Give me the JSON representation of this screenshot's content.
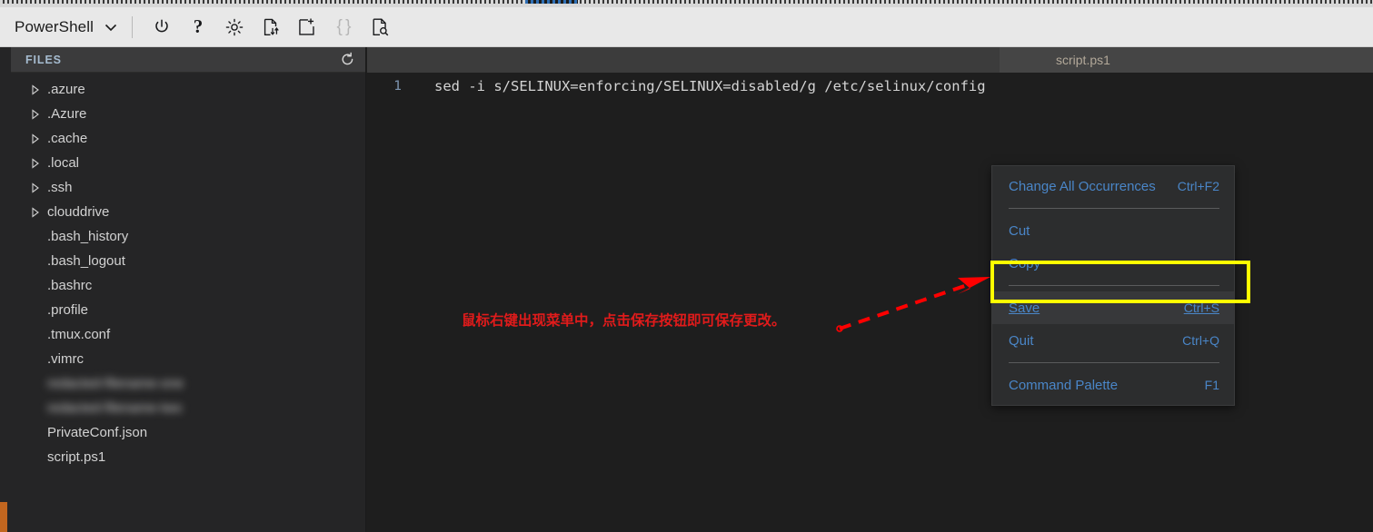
{
  "toolbar": {
    "shell_label": "PowerShell",
    "chevron_icon": "chevron-down-icon",
    "buttons": [
      {
        "name": "power-icon",
        "title": "Restart"
      },
      {
        "name": "help-icon",
        "title": "Help",
        "glyph": "?"
      },
      {
        "name": "gear-icon",
        "title": "Settings"
      },
      {
        "name": "upload-download-icon",
        "title": "Upload/Download files"
      },
      {
        "name": "new-window-icon",
        "title": "Open new session"
      },
      {
        "name": "braces-icon",
        "title": "Editor",
        "glyph": "{ }"
      },
      {
        "name": "preview-file-icon",
        "title": "Web preview"
      }
    ]
  },
  "sidebar": {
    "header_title": "FILES",
    "refresh_icon": "refresh-icon",
    "items": [
      {
        "label": ".azure",
        "type": "folder",
        "blurred": false
      },
      {
        "label": ".Azure",
        "type": "folder",
        "blurred": false
      },
      {
        "label": ".cache",
        "type": "folder",
        "blurred": false
      },
      {
        "label": ".local",
        "type": "folder",
        "blurred": false
      },
      {
        "label": ".ssh",
        "type": "folder",
        "blurred": false
      },
      {
        "label": "clouddrive",
        "type": "folder",
        "blurred": false
      },
      {
        "label": ".bash_history",
        "type": "file",
        "blurred": false
      },
      {
        "label": ".bash_logout",
        "type": "file",
        "blurred": false
      },
      {
        "label": ".bashrc",
        "type": "file",
        "blurred": false
      },
      {
        "label": ".profile",
        "type": "file",
        "blurred": false
      },
      {
        "label": ".tmux.conf",
        "type": "file",
        "blurred": false
      },
      {
        "label": ".vimrc",
        "type": "file",
        "blurred": false
      },
      {
        "label": "redacted-filename-one",
        "type": "file",
        "blurred": true
      },
      {
        "label": "redacted-filename-two",
        "type": "file",
        "blurred": true
      },
      {
        "label": "PrivateConf.json",
        "type": "file",
        "blurred": false
      },
      {
        "label": "script.ps1",
        "type": "file",
        "blurred": false
      }
    ]
  },
  "editor": {
    "tab_label": "script.ps1",
    "line_number": "1",
    "line_text": "sed -i s/SELINUX=enforcing/SELINUX=disabled/g /etc/selinux/config"
  },
  "context_menu": {
    "items": [
      {
        "label": "Change All Occurrences",
        "shortcut": "Ctrl+F2",
        "active": false,
        "separator_after": true
      },
      {
        "label": "Cut",
        "shortcut": "",
        "active": false,
        "separator_after": false
      },
      {
        "label": "Copy",
        "shortcut": "",
        "active": false,
        "separator_after": true
      },
      {
        "label": "Save",
        "shortcut": "Ctrl+S",
        "active": true,
        "separator_after": false
      },
      {
        "label": "Quit",
        "shortcut": "Ctrl+Q",
        "active": false,
        "separator_after": true
      },
      {
        "label": "Command Palette",
        "shortcut": "F1",
        "active": false,
        "separator_after": false
      }
    ]
  },
  "annotations": {
    "callout_text": "鼠标右键出现菜单中，点击保存按钮即可保存更改。",
    "highlight_color": "#ffff00",
    "arrow_color": "#ff0000",
    "callout_color": "#e01b1b"
  },
  "colors": {
    "toolbar_bg": "#e8e8e8",
    "sidebar_bg": "#252526",
    "editor_bg": "#1e1e1e",
    "menu_bg": "#2c2d2e",
    "menu_text": "#4a86c8",
    "accent_strip": "#c2661f"
  }
}
